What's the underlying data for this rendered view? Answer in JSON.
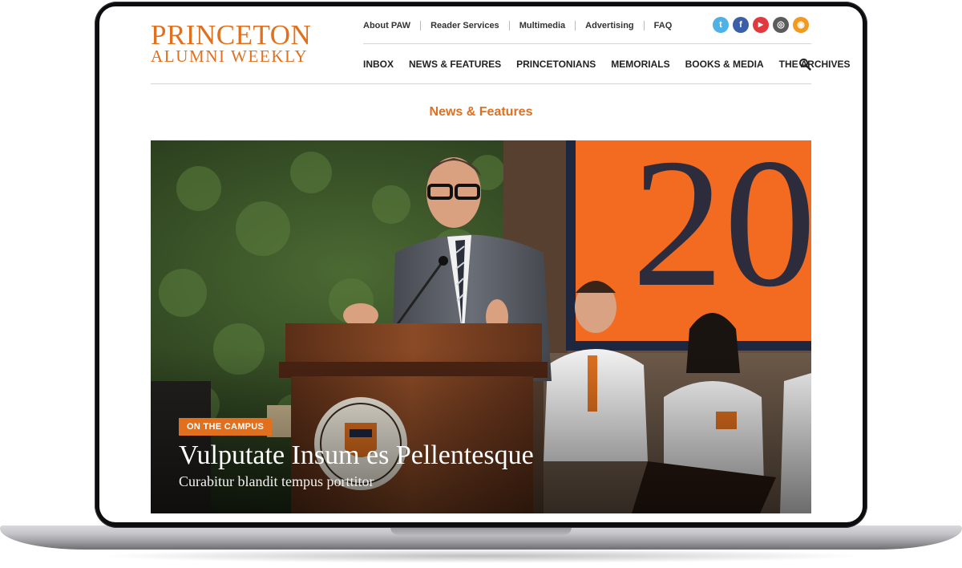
{
  "logo": {
    "line1": "PRINCETON",
    "line2": "ALUMNI WEEKLY"
  },
  "util_nav": [
    "About PAW",
    "Reader Services",
    "Multimedia",
    "Advertising",
    "FAQ"
  ],
  "social": [
    {
      "icon": "twitter-icon",
      "glyph": "t",
      "color": "#4fb2e6"
    },
    {
      "icon": "facebook-icon",
      "glyph": "f",
      "color": "#3b5ea8"
    },
    {
      "icon": "youtube-icon",
      "glyph": "▶",
      "color": "#e0393e"
    },
    {
      "icon": "instagram-icon",
      "glyph": "◎",
      "color": "#5b5b5b"
    },
    {
      "icon": "rss-icon",
      "glyph": "◉",
      "color": "#f29a1f"
    }
  ],
  "main_nav": [
    "INBOX",
    "NEWS & FEATURES",
    "PRINCETONIANS",
    "MEMORIALS",
    "BOOKS & MEDIA",
    "THE ARCHIVES"
  ],
  "search_icon": "search-icon",
  "section_title": "News & Features",
  "hero": {
    "badge": "ON THE CAMPUS",
    "headline": "Vulputate Insum es Pellentesque",
    "subhead": "Curabitur blandit tempus porttitor",
    "banner_text": "20"
  },
  "colors": {
    "accent": "#e0701e",
    "text": "#222222"
  }
}
